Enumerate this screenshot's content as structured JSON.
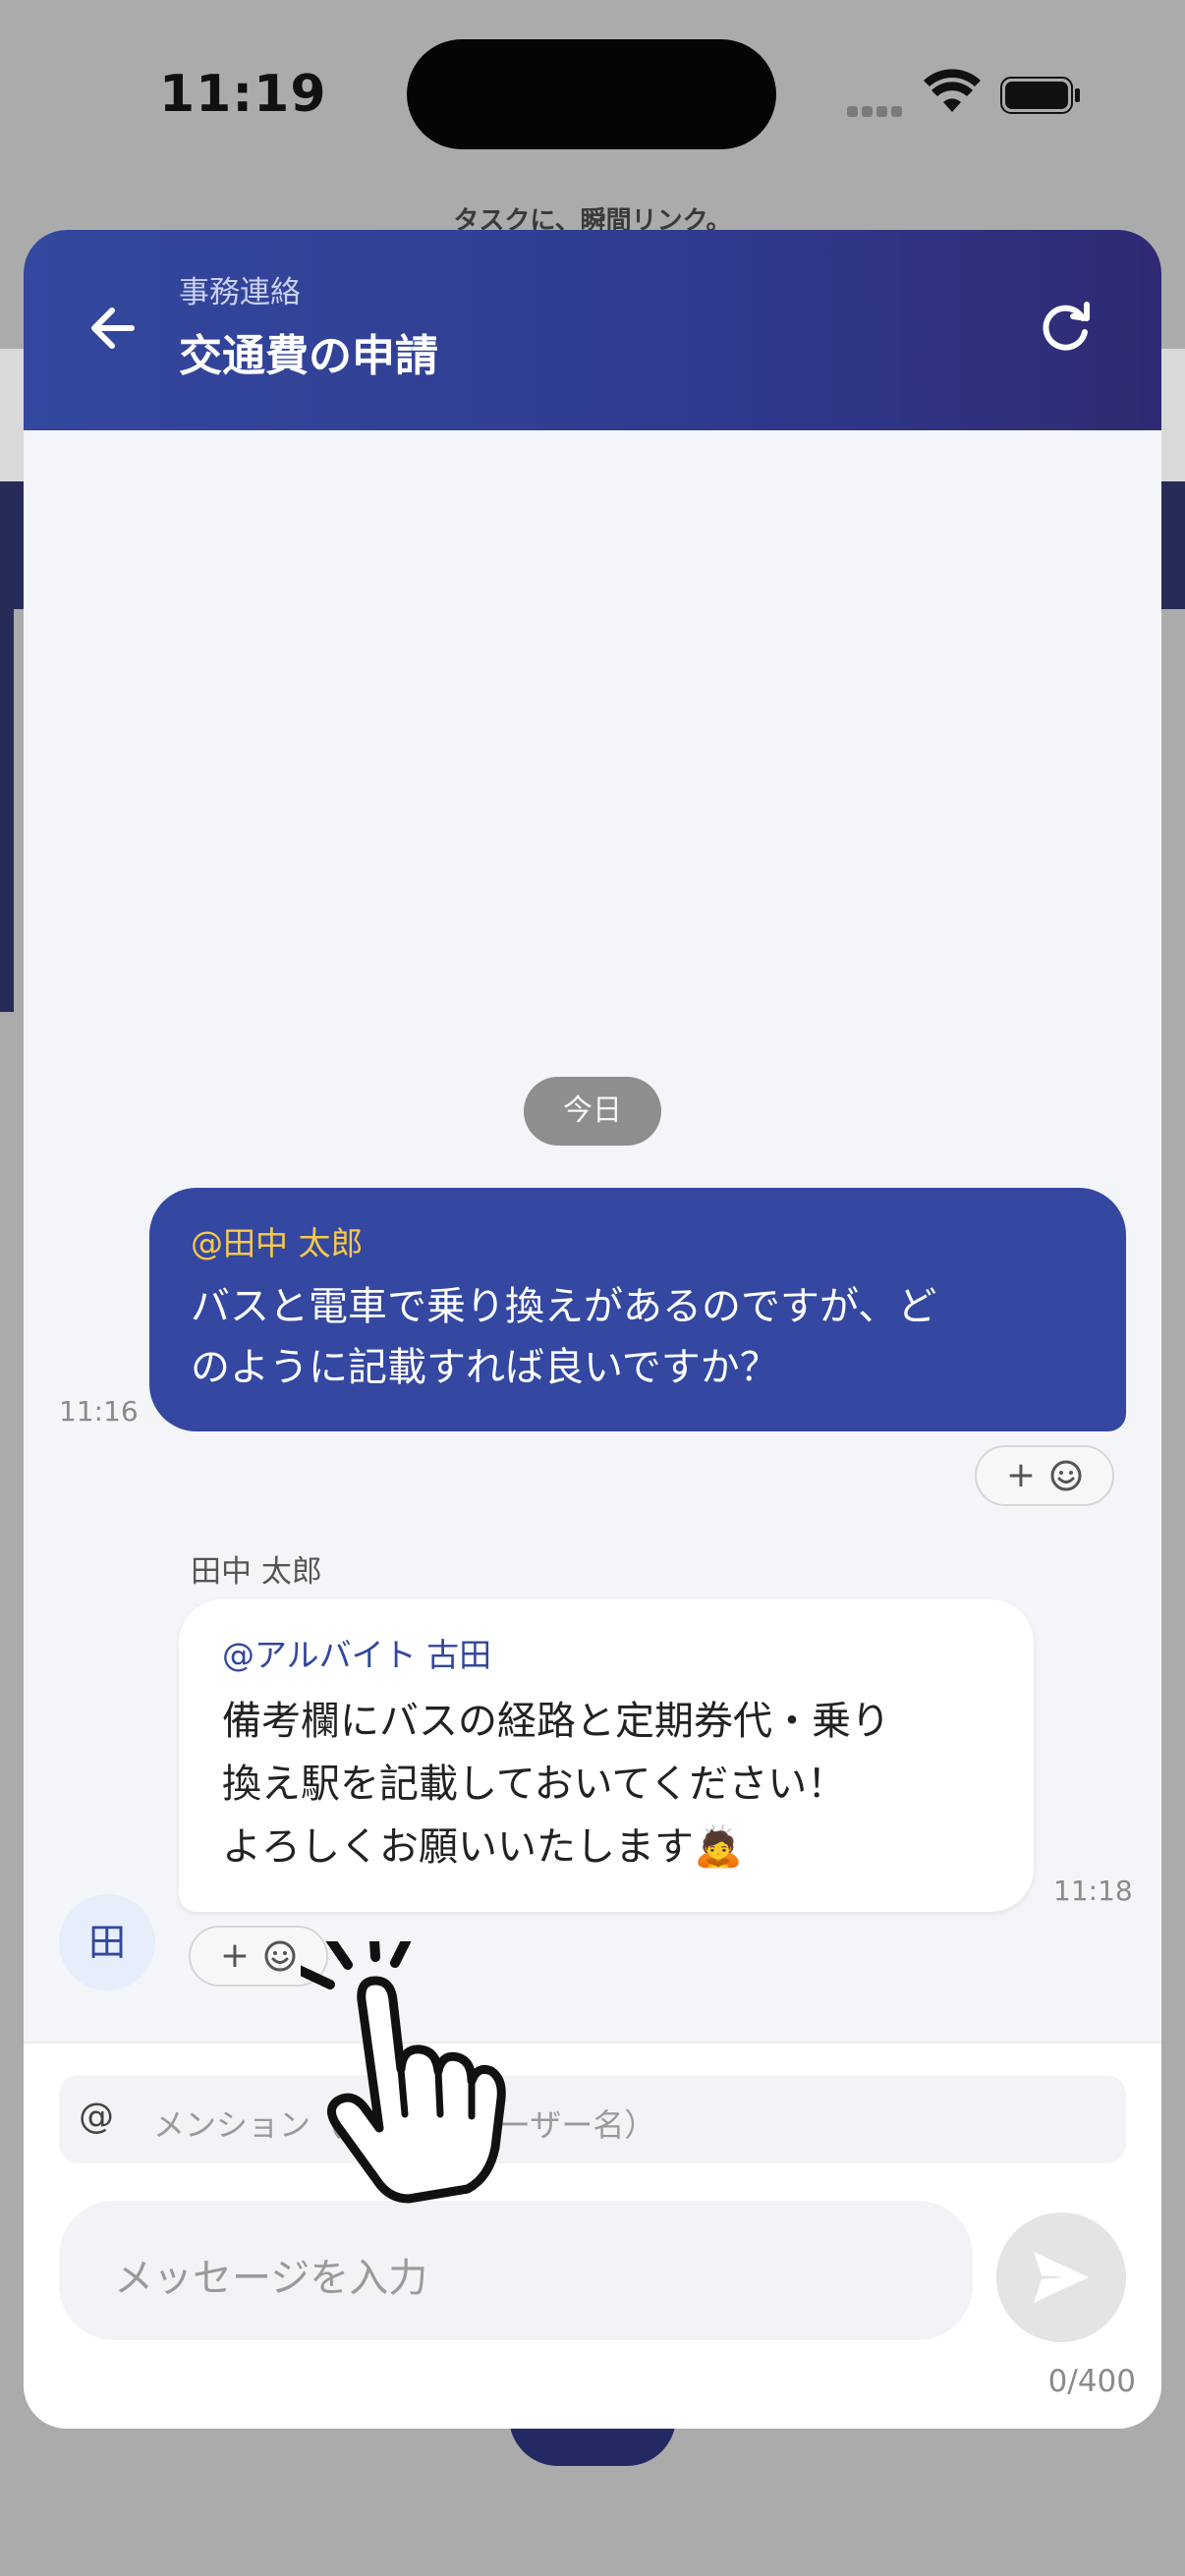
{
  "status_bar": {
    "time": "11:19"
  },
  "background": {
    "tagline": "タスクに、瞬間リンク。"
  },
  "header": {
    "category": "事務連絡",
    "title": "交通費の申請"
  },
  "date_divider": "今日",
  "messages": [
    {
      "direction": "outgoing",
      "time": "11:16",
      "mention": "@田中 太郎",
      "lines": [
        "バスと電車で乗り換えがあるのですが、ど",
        "のように記載すれば良いですか？"
      ],
      "reaction_label": "+"
    },
    {
      "direction": "incoming",
      "sender": "田中 太郎",
      "avatar_initial": "田",
      "time": "11:18",
      "mention": "@アルバイト 古田",
      "lines": [
        "備考欄にバスの経路と定期券代・乗り",
        "換え駅を記載しておいてください！",
        "よろしくお願いいたします🙇"
      ],
      "reaction_label": "+"
    }
  ],
  "composer": {
    "mention_placeholder": "メンション（送りたいユーザー名）",
    "message_placeholder": "メッセージを入力",
    "char_count": "0/400"
  },
  "colors": {
    "header_start": "#33489e",
    "header_end": "#2f2a72",
    "mention_outgoing": "#f7c948",
    "mention_incoming": "#32479c"
  },
  "icons": [
    "back-arrow-icon",
    "refresh-icon",
    "smiley-icon",
    "at-icon",
    "send-icon",
    "pointing-hand-icon"
  ]
}
